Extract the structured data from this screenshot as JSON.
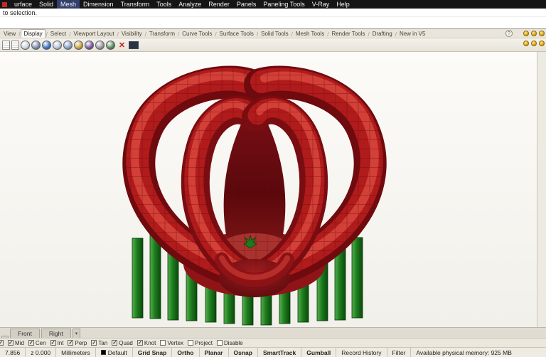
{
  "menu": {
    "items": [
      "urface",
      "Solid",
      "Mesh",
      "Dimension",
      "Transform",
      "Tools",
      "Analyze",
      "Render",
      "Panels",
      "Paneling Tools",
      "V-Ray",
      "Help"
    ],
    "active_item": "Mesh"
  },
  "command": {
    "history_line": "to selection.",
    "input_value": ""
  },
  "tab_strip": {
    "separator": "/",
    "selected": "Display",
    "tabs": [
      "View",
      "Display",
      "Select",
      "Viewport Layout",
      "Visibility",
      "Transform",
      "Curve Tools",
      "Surface Tools",
      "Solid Tools",
      "Mesh Tools",
      "Render Tools",
      "Drafting",
      "New in V5"
    ]
  },
  "toolbar": {
    "x_glyph": "✕",
    "icons": [
      {
        "name": "viewport-layout-icon",
        "type": "doc"
      },
      {
        "name": "named-views-icon",
        "type": "doc"
      },
      {
        "name": "wireframe-display-icon",
        "type": "sphere",
        "color": "#cfd6e2"
      },
      {
        "name": "shaded-display-icon",
        "type": "sphere",
        "color": "#7e8ea6"
      },
      {
        "name": "rendered-display-icon",
        "type": "sphere",
        "color": "#3f6fc2"
      },
      {
        "name": "ghosted-display-icon",
        "type": "sphere",
        "color": "#b9c6d8"
      },
      {
        "name": "xray-display-icon",
        "type": "sphere",
        "color": "#8aa0c0"
      },
      {
        "name": "raytraced-display-icon",
        "type": "sphere",
        "color": "#caa23c"
      },
      {
        "name": "artistic-display-icon",
        "type": "sphere",
        "color": "#7a5a96"
      },
      {
        "name": "pen-display-icon",
        "type": "sphere",
        "color": "#9a9a9a"
      },
      {
        "name": "flat-shade-icon",
        "type": "sphere",
        "color": "#5a8a5a"
      },
      {
        "name": "clear-display-icon",
        "type": "x",
        "color": "#c22222"
      },
      {
        "name": "fullscreen-display-icon",
        "type": "monitor",
        "color": "#2b3442"
      }
    ]
  },
  "top_right_icons": {
    "tab_row": [
      {
        "name": "help-icon",
        "type": "help",
        "glyph": "?"
      },
      {
        "name": "dock-icon-1",
        "type": "ball"
      },
      {
        "name": "dock-icon-2",
        "type": "ball"
      },
      {
        "name": "dock-icon-3",
        "type": "ball"
      }
    ],
    "toolbar_row": [
      {
        "name": "dock-icon-4",
        "type": "ball"
      },
      {
        "name": "dock-icon-5",
        "type": "ball"
      },
      {
        "name": "dock-icon-6",
        "type": "ball"
      }
    ]
  },
  "viewport": {
    "model_colors": {
      "petal_dark": "#6f0a0e",
      "petal_mid": "#b01b1b",
      "petal_highlight": "#d8463c",
      "interior": "#5a080c",
      "support_green": "#1e7c1e",
      "sprout_green": "#1d7a1d"
    }
  },
  "viewport_tabs": {
    "partial_left_tab": true,
    "tabs": [
      "Front",
      "Right"
    ],
    "menu_glyph": "▾"
  },
  "osnap": {
    "check_glyph": "✓",
    "partial_left": true,
    "items": [
      {
        "label": "Mid",
        "checked": true
      },
      {
        "label": "Cen",
        "checked": true
      },
      {
        "label": "Int",
        "checked": true
      },
      {
        "label": "Perp",
        "checked": true
      },
      {
        "label": "Tan",
        "checked": true
      },
      {
        "label": "Quad",
        "checked": true
      },
      {
        "label": "Knot",
        "checked": true
      },
      {
        "label": "Vertex",
        "checked": false
      },
      {
        "label": "Project",
        "checked": false
      },
      {
        "label": "Disable",
        "checked": false
      }
    ]
  },
  "status_bar": {
    "segments": [
      {
        "name": "coord-x",
        "text": "7.856",
        "interactable": false
      },
      {
        "name": "coord-z",
        "text": "z 0.000",
        "interactable": false
      },
      {
        "name": "units",
        "text": "Millimeters",
        "interactable": true
      },
      {
        "name": "layer",
        "text": "Default",
        "swatch": "#000000",
        "interactable": true
      },
      {
        "name": "grid-snap",
        "text": "Grid Snap",
        "bold": true,
        "interactable": true
      },
      {
        "name": "ortho",
        "text": "Ortho",
        "bold": true,
        "interactable": true
      },
      {
        "name": "planar",
        "text": "Planar",
        "bold": true,
        "interactable": true
      },
      {
        "name": "osnap-toggle",
        "text": "Osnap",
        "bold": true,
        "interactable": true
      },
      {
        "name": "smarttrack",
        "text": "SmartTrack",
        "bold": true,
        "interactable": true
      },
      {
        "name": "gumball",
        "text": "Gumball",
        "bold": true,
        "interactable": true
      },
      {
        "name": "record-history",
        "text": "Record History",
        "interactable": true
      },
      {
        "name": "filter",
        "text": "Filter",
        "interactable": true
      },
      {
        "name": "memory",
        "text": "Available physical memory: 925 MB",
        "fill": true,
        "interactable": false
      }
    ]
  }
}
